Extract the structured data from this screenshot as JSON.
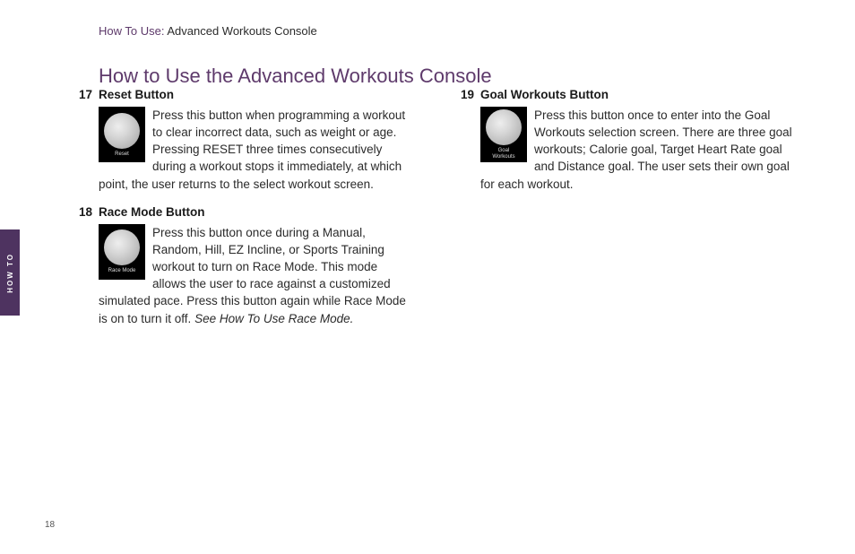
{
  "breadcrumb": {
    "prefix": "How To Use:",
    "current": " Advanced Workouts Console"
  },
  "sideTab": "HOW TO",
  "title": "How to Use the Advanced Workouts Console",
  "pageNumber": "18",
  "col1": [
    {
      "num": "17",
      "heading": "Reset Button",
      "iconLabel": "Reset",
      "text": "Press this button when programming a workout to clear incorrect data, such as weight or age. Pressing RESET three times consecutively during a workout stops it immediately, at which point, the user returns to the select workout screen."
    },
    {
      "num": "18",
      "heading": "Race Mode Button",
      "iconLabel": "Race Mode",
      "text": "Press this button once during a Manual, Random, Hill, EZ Incline, or Sports Training workout to turn on Race Mode. This mode allows the user to race against a customized simulated pace. Press this button again while Race Mode is on to turn it off. ",
      "italicTail": "See How To Use Race Mode."
    }
  ],
  "col2": [
    {
      "num": "19",
      "heading": "Goal Workouts Button",
      "iconLabel": "Goal\nWorkouts",
      "text": "Press this button once to enter into the Goal Workouts selection screen. There are three goal workouts; Calorie goal, Target Heart Rate goal and Distance goal. The user sets their own goal for each workout."
    }
  ]
}
